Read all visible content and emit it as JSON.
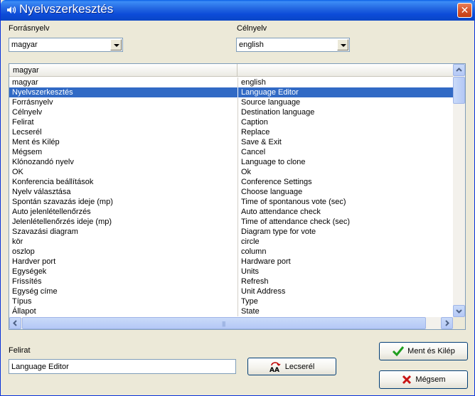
{
  "window": {
    "title": "Nyelvszerkesztés",
    "close_glyph": "✕"
  },
  "source": {
    "label": "Forrásnyelv",
    "value": "magyar"
  },
  "target": {
    "label": "Célnyelv",
    "value": "english"
  },
  "table": {
    "header": [
      "magyar",
      ""
    ],
    "selected_index": 1,
    "rows": [
      [
        "magyar",
        "english"
      ],
      [
        "Nyelvszerkesztés",
        "Language Editor"
      ],
      [
        "Forrásnyelv",
        "Source language"
      ],
      [
        "Célnyelv",
        "Destination language"
      ],
      [
        "Felirat",
        "Caption"
      ],
      [
        "Lecserél",
        "Replace"
      ],
      [
        "Ment és Kilép",
        "Save & Exit"
      ],
      [
        "Mégsem",
        "Cancel"
      ],
      [
        "Klónozandó nyelv",
        "Language to clone"
      ],
      [
        "OK",
        "Ok"
      ],
      [
        "Konferencia beállítások",
        "Conference Settings"
      ],
      [
        "Nyelv választása",
        "Choose language"
      ],
      [
        "Spontán szavazás ideje (mp)",
        "Time of spontanous vote (sec)"
      ],
      [
        "Auto jelenlétellenőrzés",
        "Auto attendance check"
      ],
      [
        "Jelenlétellenőrzés ideje (mp)",
        "Time of attendance check (sec)"
      ],
      [
        "Szavazási diagram",
        "Diagram type for vote"
      ],
      [
        "kör",
        "circle"
      ],
      [
        "oszlop",
        "column"
      ],
      [
        "Hardver port",
        "Hardware port"
      ],
      [
        "Egységek",
        "Units"
      ],
      [
        "Frissítés",
        "Refresh"
      ],
      [
        "Egység címe",
        "Unit Address"
      ],
      [
        "Típus",
        "Type"
      ],
      [
        "Állapot",
        "State"
      ]
    ]
  },
  "caption": {
    "label": "Felirat",
    "value": "Language Editor"
  },
  "buttons": {
    "replace": "Lecserél",
    "save_exit": "Ment és Kilép",
    "cancel": "Mégsem"
  },
  "icons": {
    "title": "speaker-icon",
    "replace": "replace-aa-icon",
    "save": "checkmark-icon",
    "cancel": "cross-icon"
  },
  "colors": {
    "selection": "#316AC5",
    "titlebar": "#0A46C6"
  }
}
